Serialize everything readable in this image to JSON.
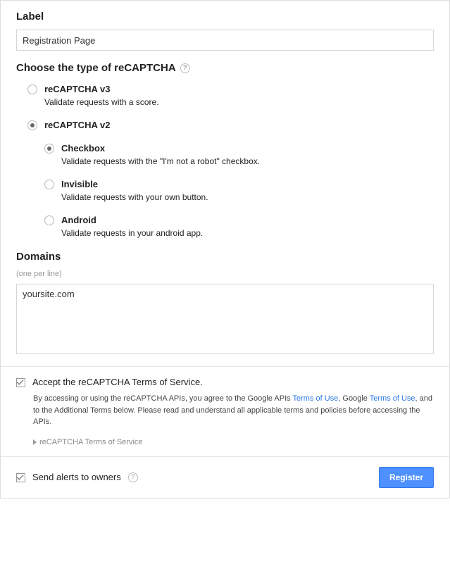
{
  "label_section": {
    "heading": "Label",
    "value": "Registration Page"
  },
  "type_section": {
    "heading": "Choose the type of reCAPTCHA",
    "options": [
      {
        "label": "reCAPTCHA v3",
        "desc": "Validate requests with a score.",
        "selected": false
      },
      {
        "label": "reCAPTCHA v2",
        "desc": "",
        "selected": true
      }
    ],
    "sub_options": [
      {
        "label": "Checkbox",
        "desc": "Validate requests with the \"I'm not a robot\" checkbox.",
        "selected": true
      },
      {
        "label": "Invisible",
        "desc": "Validate requests with your own button.",
        "selected": false
      },
      {
        "label": "Android",
        "desc": "Validate requests in your android app.",
        "selected": false
      }
    ]
  },
  "domains_section": {
    "heading": "Domains",
    "hint": "(one per line)",
    "value": "yoursite.com"
  },
  "terms_section": {
    "accept_label": "Accept the reCAPTCHA Terms of Service.",
    "text_before": "By accessing or using the reCAPTCHA APIs, you agree to the Google APIs ",
    "link1": "Terms of Use",
    "text_mid1": ", Google ",
    "link2": "Terms of Use",
    "text_after": ", and to the Additional Terms below. Please read and understand all applicable terms and policies before accessing the APIs.",
    "expand_label": "reCAPTCHA Terms of Service"
  },
  "footer": {
    "alerts_label": "Send alerts to owners",
    "register_label": "Register"
  }
}
